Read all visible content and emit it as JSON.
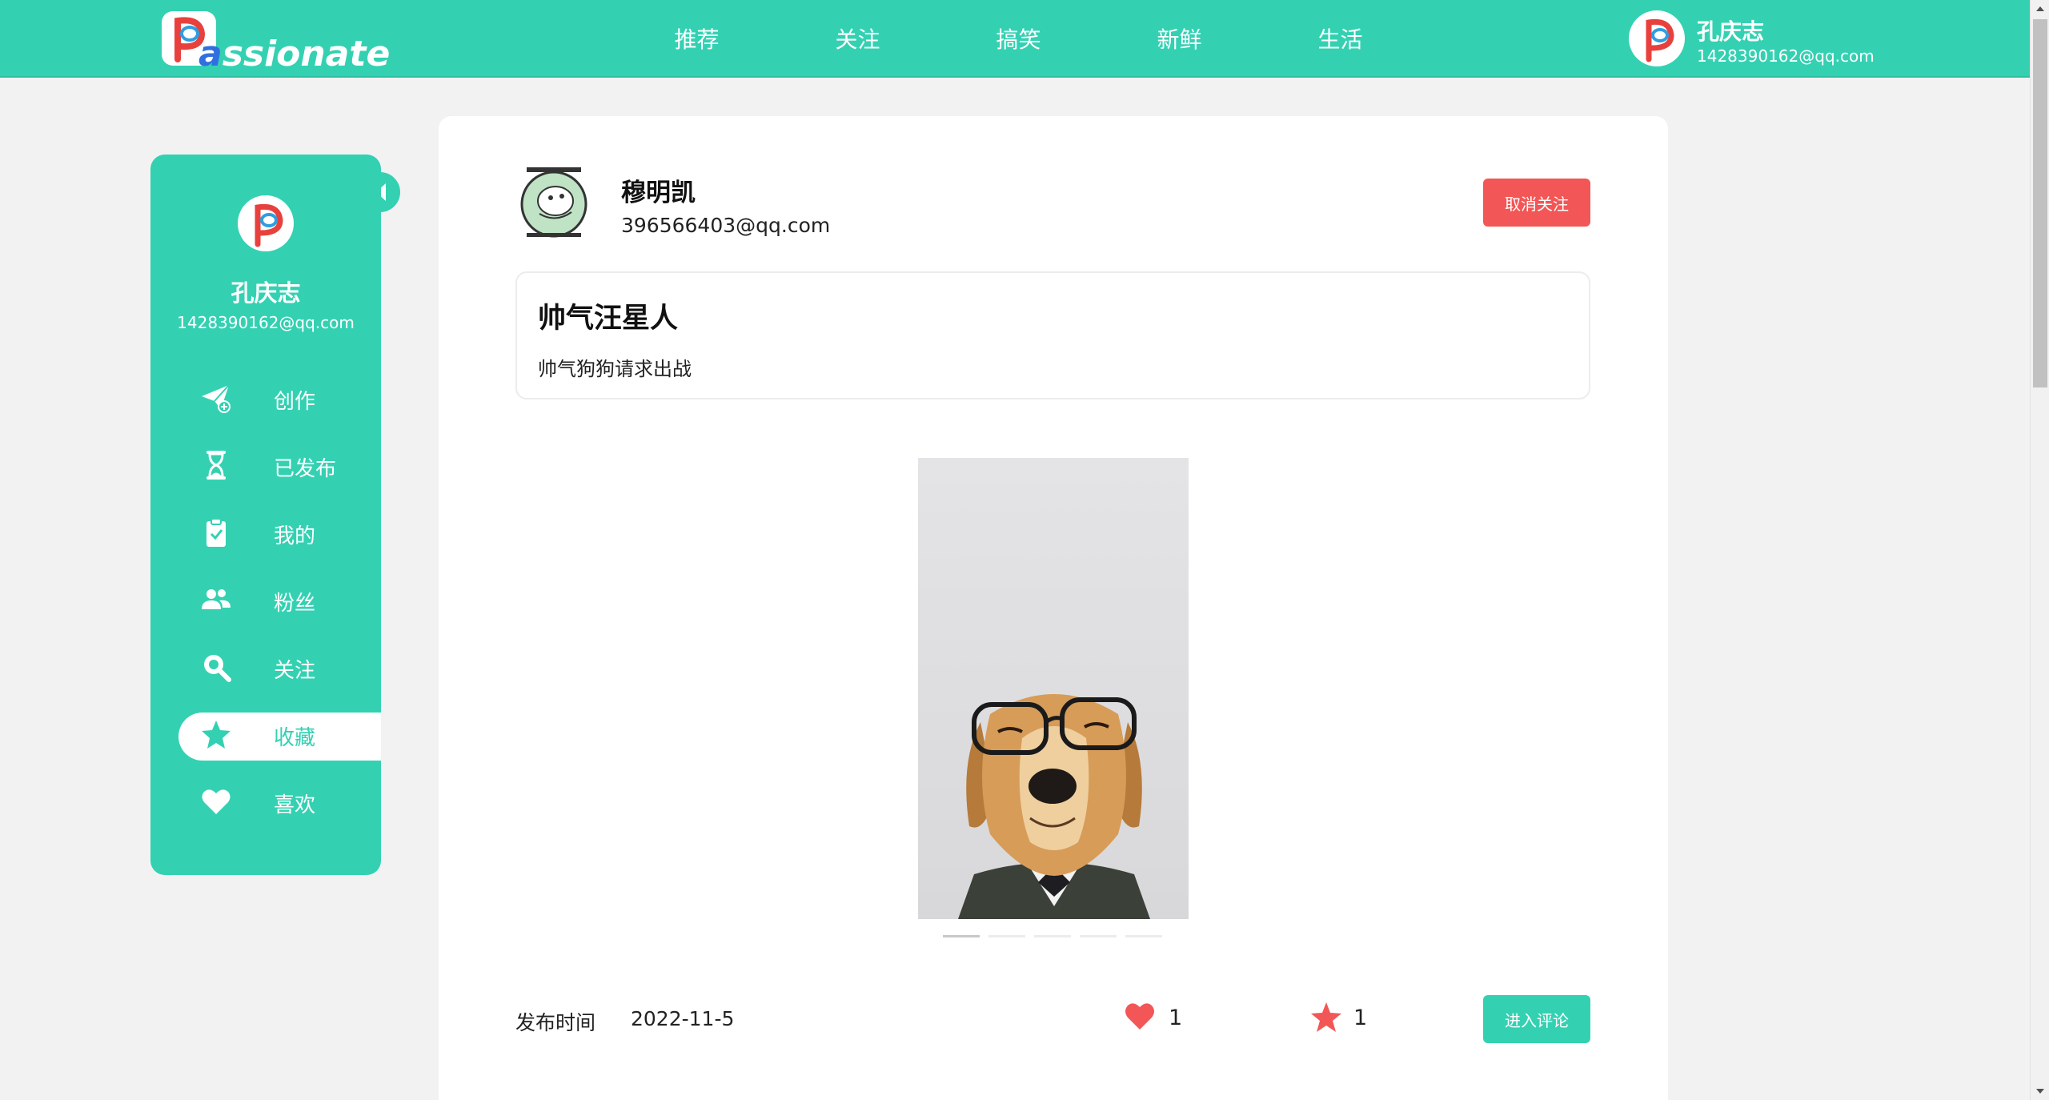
{
  "brand": {
    "logo_text_accent": "a",
    "logo_text_rest": "ssionate",
    "logo_letter": "P",
    "color_primary": "#33d1b2",
    "color_danger": "#f25656"
  },
  "nav": {
    "items": [
      {
        "label": "推荐"
      },
      {
        "label": "关注"
      },
      {
        "label": "搞笑"
      },
      {
        "label": "新鲜"
      },
      {
        "label": "生活"
      }
    ]
  },
  "current_user": {
    "name": "孔庆志",
    "email": "1428390162@qq.com"
  },
  "sidebar": {
    "items": [
      {
        "label": "创作",
        "icon": "paper-plane-add-icon"
      },
      {
        "label": "已发布",
        "icon": "hourglass-icon"
      },
      {
        "label": "我的",
        "icon": "clipboard-check-icon"
      },
      {
        "label": "粉丝",
        "icon": "users-icon"
      },
      {
        "label": "关注",
        "icon": "search-icon"
      },
      {
        "label": "收藏",
        "icon": "star-icon",
        "active": true
      },
      {
        "label": "喜欢",
        "icon": "heart-icon"
      }
    ]
  },
  "post": {
    "author_name": "穆明凯",
    "author_email": "396566403@qq.com",
    "unfollow_label": "取消关注",
    "title": "帅气汪星人",
    "text": "帅气狗狗请求出战",
    "image": "golden-retriever-with-glasses-photo",
    "carousel_count": 5,
    "carousel_active": 1,
    "date_label": "发布时间",
    "date_value": "2022-11-5",
    "likes": "1",
    "favorites": "1",
    "comment_label": "进入评论"
  }
}
